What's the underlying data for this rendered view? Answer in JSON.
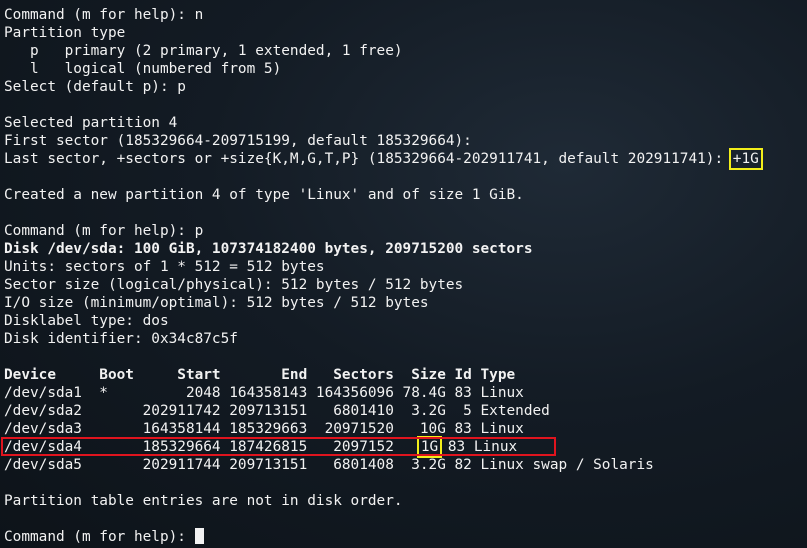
{
  "window": {
    "type": "terminal",
    "app": "fdisk"
  },
  "lines": {
    "l1": "Command (m for help): n",
    "l2": "Partition type",
    "l3": "   p   primary (2 primary, 1 extended, 1 free)",
    "l4": "   l   logical (numbered from 5)",
    "l5": "Select (default p): p",
    "l7": "Selected partition 4",
    "l8": "First sector (185329664-209715199, default 185329664):",
    "l9_prefix": "Last sector, +sectors or +size{K,M,G,T,P} (185329664-202911741, default 202911741): ",
    "l9_input": "+1G",
    "l11": "Created a new partition 4 of type 'Linux' and of size 1 GiB.",
    "l13": "Command (m for help): p",
    "l14": "Disk /dev/sda: 100 GiB, 107374182400 bytes, 209715200 sectors",
    "l15": "Units: sectors of 1 * 512 = 512 bytes",
    "l16": "Sector size (logical/physical): 512 bytes / 512 bytes",
    "l17": "I/O size (minimum/optimal): 512 bytes / 512 bytes",
    "l18": "Disklabel type: dos",
    "l19": "Disk identifier: 0x34c87c5f",
    "l27": "Partition table entries are not in disk order.",
    "prompt": "Command (m for help): "
  },
  "partition_table": {
    "header": "Device     Boot     Start       End   Sectors  Size Id Type",
    "rows": [
      {
        "text": "/dev/sda1  *         2048 164358143 164356096 78.4G 83 Linux"
      },
      {
        "text": "/dev/sda2       202911742 209713151   6801410  3.2G  5 Extended"
      },
      {
        "text": "/dev/sda3       164358144 185329663  20971520   10G 83 Linux"
      },
      {
        "pre": "/dev/sda4       185329664 187426815   2097152   ",
        "size": "1G",
        "post": " 83 Linux"
      },
      {
        "text": "/dev/sda5       202911744 209713151   6801408  3.2G 82 Linux swap / Solaris"
      }
    ]
  },
  "colors": {
    "highlight_box": "#f2ee1a",
    "row_box": "#e0141e",
    "text": "#f2f2f2"
  }
}
